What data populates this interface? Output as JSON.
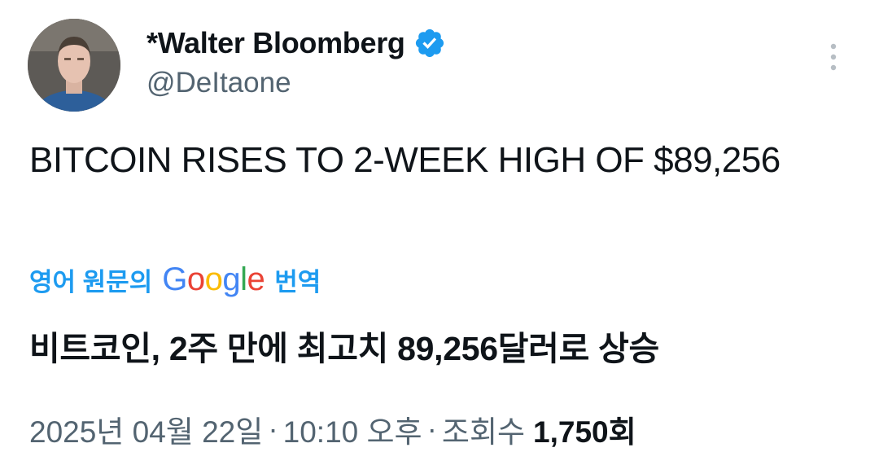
{
  "author": {
    "display_name": "*Walter Bloomberg",
    "handle": "@DeItaone",
    "verified": true,
    "verified_color": "#1d9bf0",
    "avatar_icon": "user-photo"
  },
  "tweet": {
    "text": "BITCOIN RISES TO 2-WEEK HIGH OF $89,256",
    "translate": {
      "prefix": "영어 원문의",
      "logo_letters": [
        "G",
        "o",
        "o",
        "g",
        "l",
        "e"
      ],
      "suffix": "번역"
    },
    "translated_text": "비트코인, 2주 만에 최고치 89,256달러로 상승"
  },
  "meta": {
    "date": "2025년 04월 22일",
    "separator": "·",
    "time": "10:10 오후",
    "views_label": "조회수",
    "views_count": "1,750회"
  },
  "icons": {
    "more": "more-vertical-icon",
    "verified": "verified-badge-icon"
  },
  "colors": {
    "accent": "#1d9bf0",
    "text_primary": "#0f1419",
    "text_secondary": "#536471"
  }
}
